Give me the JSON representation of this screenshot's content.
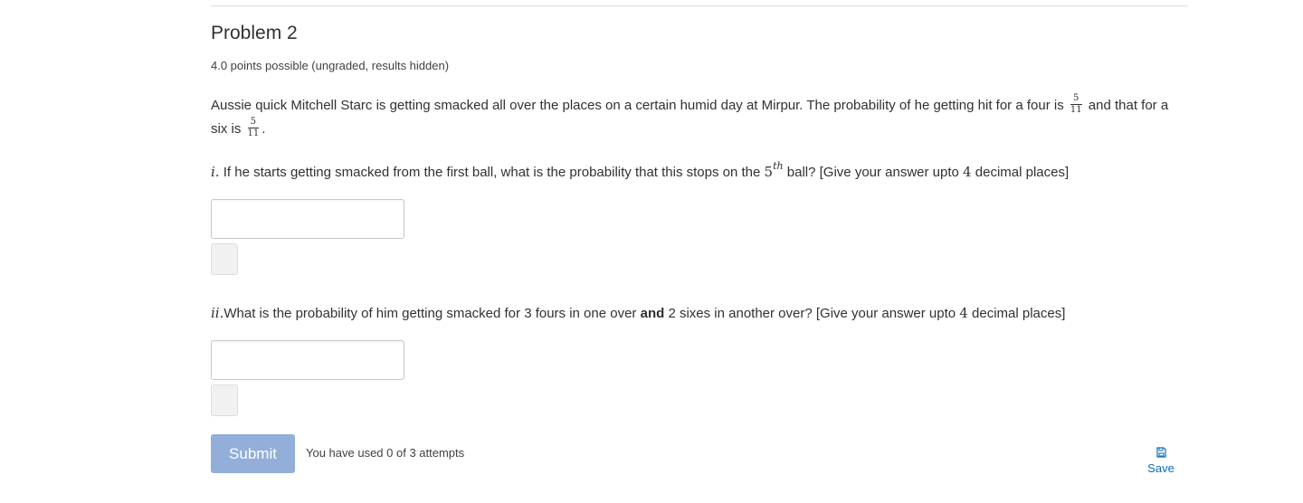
{
  "problem": {
    "title": "Problem 2",
    "points": "4.0 points possible (ungraded, results hidden)",
    "intro_part1": "Aussie quick Mitchell Starc is getting smacked all over the places on a certain humid day at Mirpur. The probability of he getting hit for a four is ",
    "frac_four_num": "5",
    "frac_four_den": "11",
    "intro_part2": " and that for a six is ",
    "frac_six_num": "5",
    "frac_six_den": "11",
    "intro_part3": "."
  },
  "question1": {
    "label": "i.",
    "text_a": " If he starts getting smacked from the first ball, what is the probability that this stops on the ",
    "ordinal_num": "5",
    "ordinal_sup": "th",
    "text_b": " ball? [Give your answer upto ",
    "decimals": "4",
    "text_c": " decimal places]",
    "answer_value": ""
  },
  "question2": {
    "label": "ii.",
    "text_a": "What is the probability of him getting smacked for 3 fours in one over ",
    "bold_word": "and",
    "text_b": " 2 sixes in another over? [Give your answer upto ",
    "decimals": "4",
    "text_c": " decimal places]",
    "answer_value": ""
  },
  "actions": {
    "submit_label": "Submit",
    "attempts_text": "You have used 0 of 3 attempts",
    "save_label": "Save",
    "save_icon": "floppy-disk-icon"
  },
  "colors": {
    "submit_bg": "#92aed9",
    "link": "#0a6fb8",
    "text": "#313131"
  }
}
